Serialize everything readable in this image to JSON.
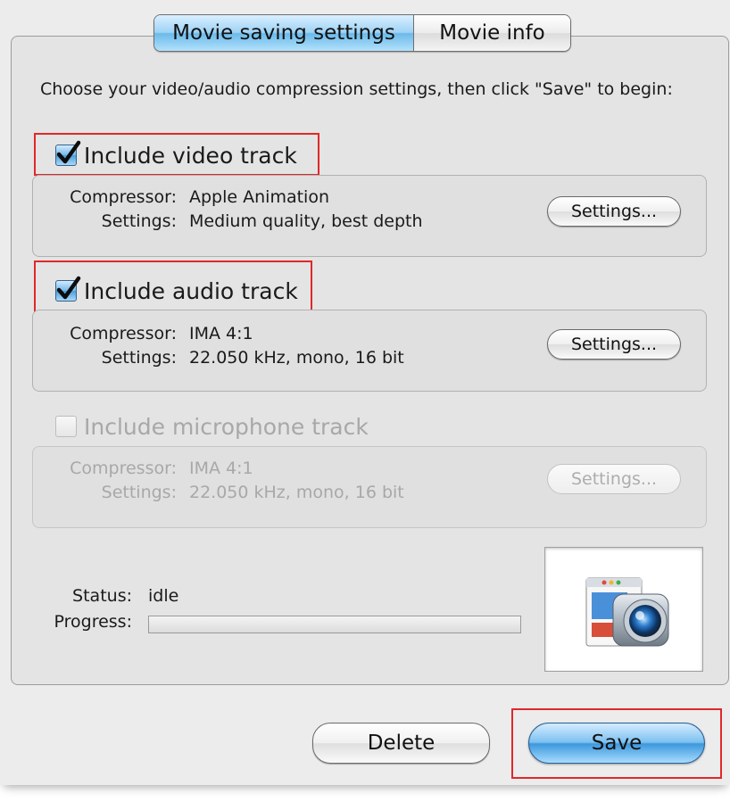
{
  "tabs": [
    {
      "label": "Movie saving settings",
      "active": true
    },
    {
      "label": "Movie info",
      "active": false
    }
  ],
  "intro_text": "Choose your video/audio compression settings, then click \"Save\" to begin:",
  "video": {
    "checkbox_label": "Include video track",
    "checked": true,
    "compressor_label": "Compressor:",
    "compressor_value": "Apple Animation",
    "settings_label": "Settings:",
    "settings_value": "Medium quality, best depth",
    "button_label": "Settings..."
  },
  "audio": {
    "checkbox_label": "Include audio track",
    "checked": true,
    "compressor_label": "Compressor:",
    "compressor_value": "IMA 4:1",
    "settings_label": "Settings:",
    "settings_value": "22.050 kHz, mono, 16 bit",
    "button_label": "Settings..."
  },
  "microphone": {
    "checkbox_label": "Include microphone track",
    "checked": false,
    "enabled": false,
    "compressor_label": "Compressor:",
    "compressor_value": "IMA 4:1",
    "settings_label": "Settings:",
    "settings_value": "22.050 kHz, mono, 16 bit",
    "button_label": "Settings..."
  },
  "status": {
    "status_label": "Status:",
    "status_value": "idle",
    "progress_label": "Progress:",
    "progress_fraction": 0
  },
  "icon": "camera-screen-recorder-icon",
  "buttons": {
    "delete_label": "Delete",
    "save_label": "Save"
  },
  "colors": {
    "highlight": "#e0282a",
    "accent_blue": "#4b9ddc"
  }
}
